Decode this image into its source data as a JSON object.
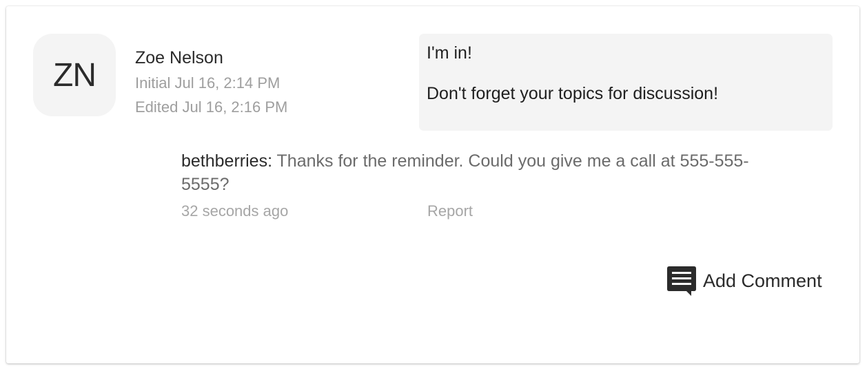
{
  "comment": {
    "avatar_initials": "ZN",
    "author_name": "Zoe Nelson",
    "initial_timestamp": "Initial Jul 16, 2:14 PM",
    "edited_timestamp": "Edited Jul 16, 2:16 PM",
    "message_lines": [
      "I'm in!",
      "Don't forget your topics for discussion!"
    ]
  },
  "reply": {
    "username": "bethberries:",
    "text": " Thanks for the reminder.  Could you give me a call at 555-555-5555?",
    "time": "32 seconds ago",
    "report_label": "Report"
  },
  "actions": {
    "add_comment_label": "Add Comment",
    "add_comment_icon": "comment-icon"
  },
  "colors": {
    "message_background": "#f4f4f4",
    "avatar_background": "#f4f4f4",
    "muted_text": "#9e9e9e",
    "primary_text": "#2b2b2b"
  }
}
